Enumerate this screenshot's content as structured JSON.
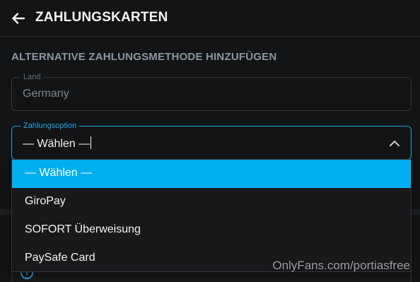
{
  "header": {
    "back_icon": "arrow-left-icon",
    "title": "ZAHLUNGSKARTEN"
  },
  "section": {
    "title": "ALTERNATIVE ZAHLUNGSMETHODE HINZUFÜGEN"
  },
  "country_field": {
    "label": "Land",
    "value": "Germany"
  },
  "payment_option_field": {
    "label": "Zahlungsoption",
    "value": "— Wählen —",
    "chevron_icon": "chevron-up-icon"
  },
  "dropdown": {
    "options": [
      {
        "label": "— Wählen —",
        "selected": true
      },
      {
        "label": "GiroPay",
        "selected": false
      },
      {
        "label": "SOFORT Überweisung",
        "selected": false
      },
      {
        "label": "PaySafe Card",
        "selected": false
      }
    ]
  },
  "notice": {
    "icon": "info-icon"
  },
  "watermark": "OnlyFans.com/portiasfree",
  "colors": {
    "background": "#121415",
    "accent": "#00aff0",
    "focus_border": "#1ca7de",
    "muted_text": "#8a96a3"
  }
}
